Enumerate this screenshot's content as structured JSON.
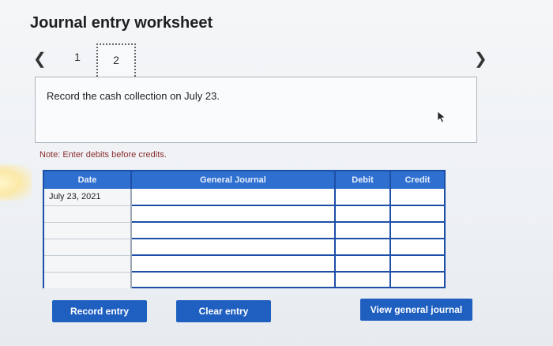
{
  "header": {
    "title": "Journal entry worksheet"
  },
  "pagination": {
    "prev_icon": "chevron-left-icon",
    "next_icon": "chevron-right-icon",
    "pages": [
      "1",
      "2"
    ],
    "current_page": "2"
  },
  "prompt": {
    "text": "Record the cash collection on July 23."
  },
  "note": {
    "text": "Note: Enter debits before credits."
  },
  "journal_table": {
    "columns": [
      "Date",
      "General Journal",
      "Debit",
      "Credit"
    ],
    "rows": [
      [
        "July 23, 2021",
        "",
        "",
        ""
      ],
      [
        "",
        "",
        "",
        ""
      ],
      [
        "",
        "",
        "",
        ""
      ],
      [
        "",
        "",
        "",
        ""
      ],
      [
        "",
        "",
        "",
        ""
      ],
      [
        "",
        "",
        "",
        ""
      ]
    ]
  },
  "buttons": {
    "record": "Record entry",
    "clear": "Clear entry",
    "view": "View general journal"
  },
  "colors": {
    "accent": "#1f5fc0",
    "header_fill": "#2f6fd0",
    "grid_border": "#1d4fa8",
    "note": "#8a2f2f"
  }
}
